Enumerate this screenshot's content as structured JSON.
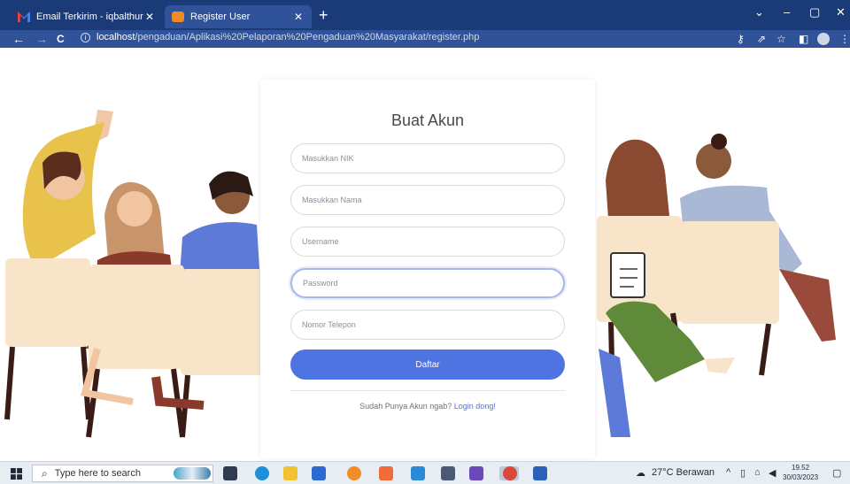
{
  "browser": {
    "tabs": [
      {
        "title": "Email Terkirim - iqbalthursina@g",
        "active": false
      },
      {
        "title": "Register User",
        "active": true
      }
    ],
    "new_tab_label": "+",
    "window_controls": {
      "collapse": "⌄",
      "minimize": "–",
      "restore": "▢",
      "close": "✕"
    },
    "nav": {
      "back": "←",
      "forward": "→",
      "reload": "C"
    },
    "url": {
      "host": "localhost",
      "path": "/pengaduan/Aplikasi%20Pelaporan%20Pengaduan%20Masyarakat/register.php"
    }
  },
  "form": {
    "title": "Buat Akun",
    "fields": {
      "nik_placeholder": "Masukkan NIK",
      "nama_placeholder": "Masukkan Nama",
      "username_placeholder": "Username",
      "password_placeholder": "Password",
      "telepon_placeholder": "Nomor Telepon"
    },
    "submit_label": "Daftar",
    "login_prompt": "Sudah Punya Akun ngab?",
    "login_link": "Login dong!"
  },
  "taskbar": {
    "search_placeholder": "Type here to search",
    "weather": "27°C  Berawan",
    "time": "19.52",
    "date": "30/03/2023"
  },
  "colors": {
    "tab_strip": "#1a3a78",
    "toolbar": "#2f5299",
    "primary_button": "#4d74e0",
    "link": "#4d74e0"
  }
}
